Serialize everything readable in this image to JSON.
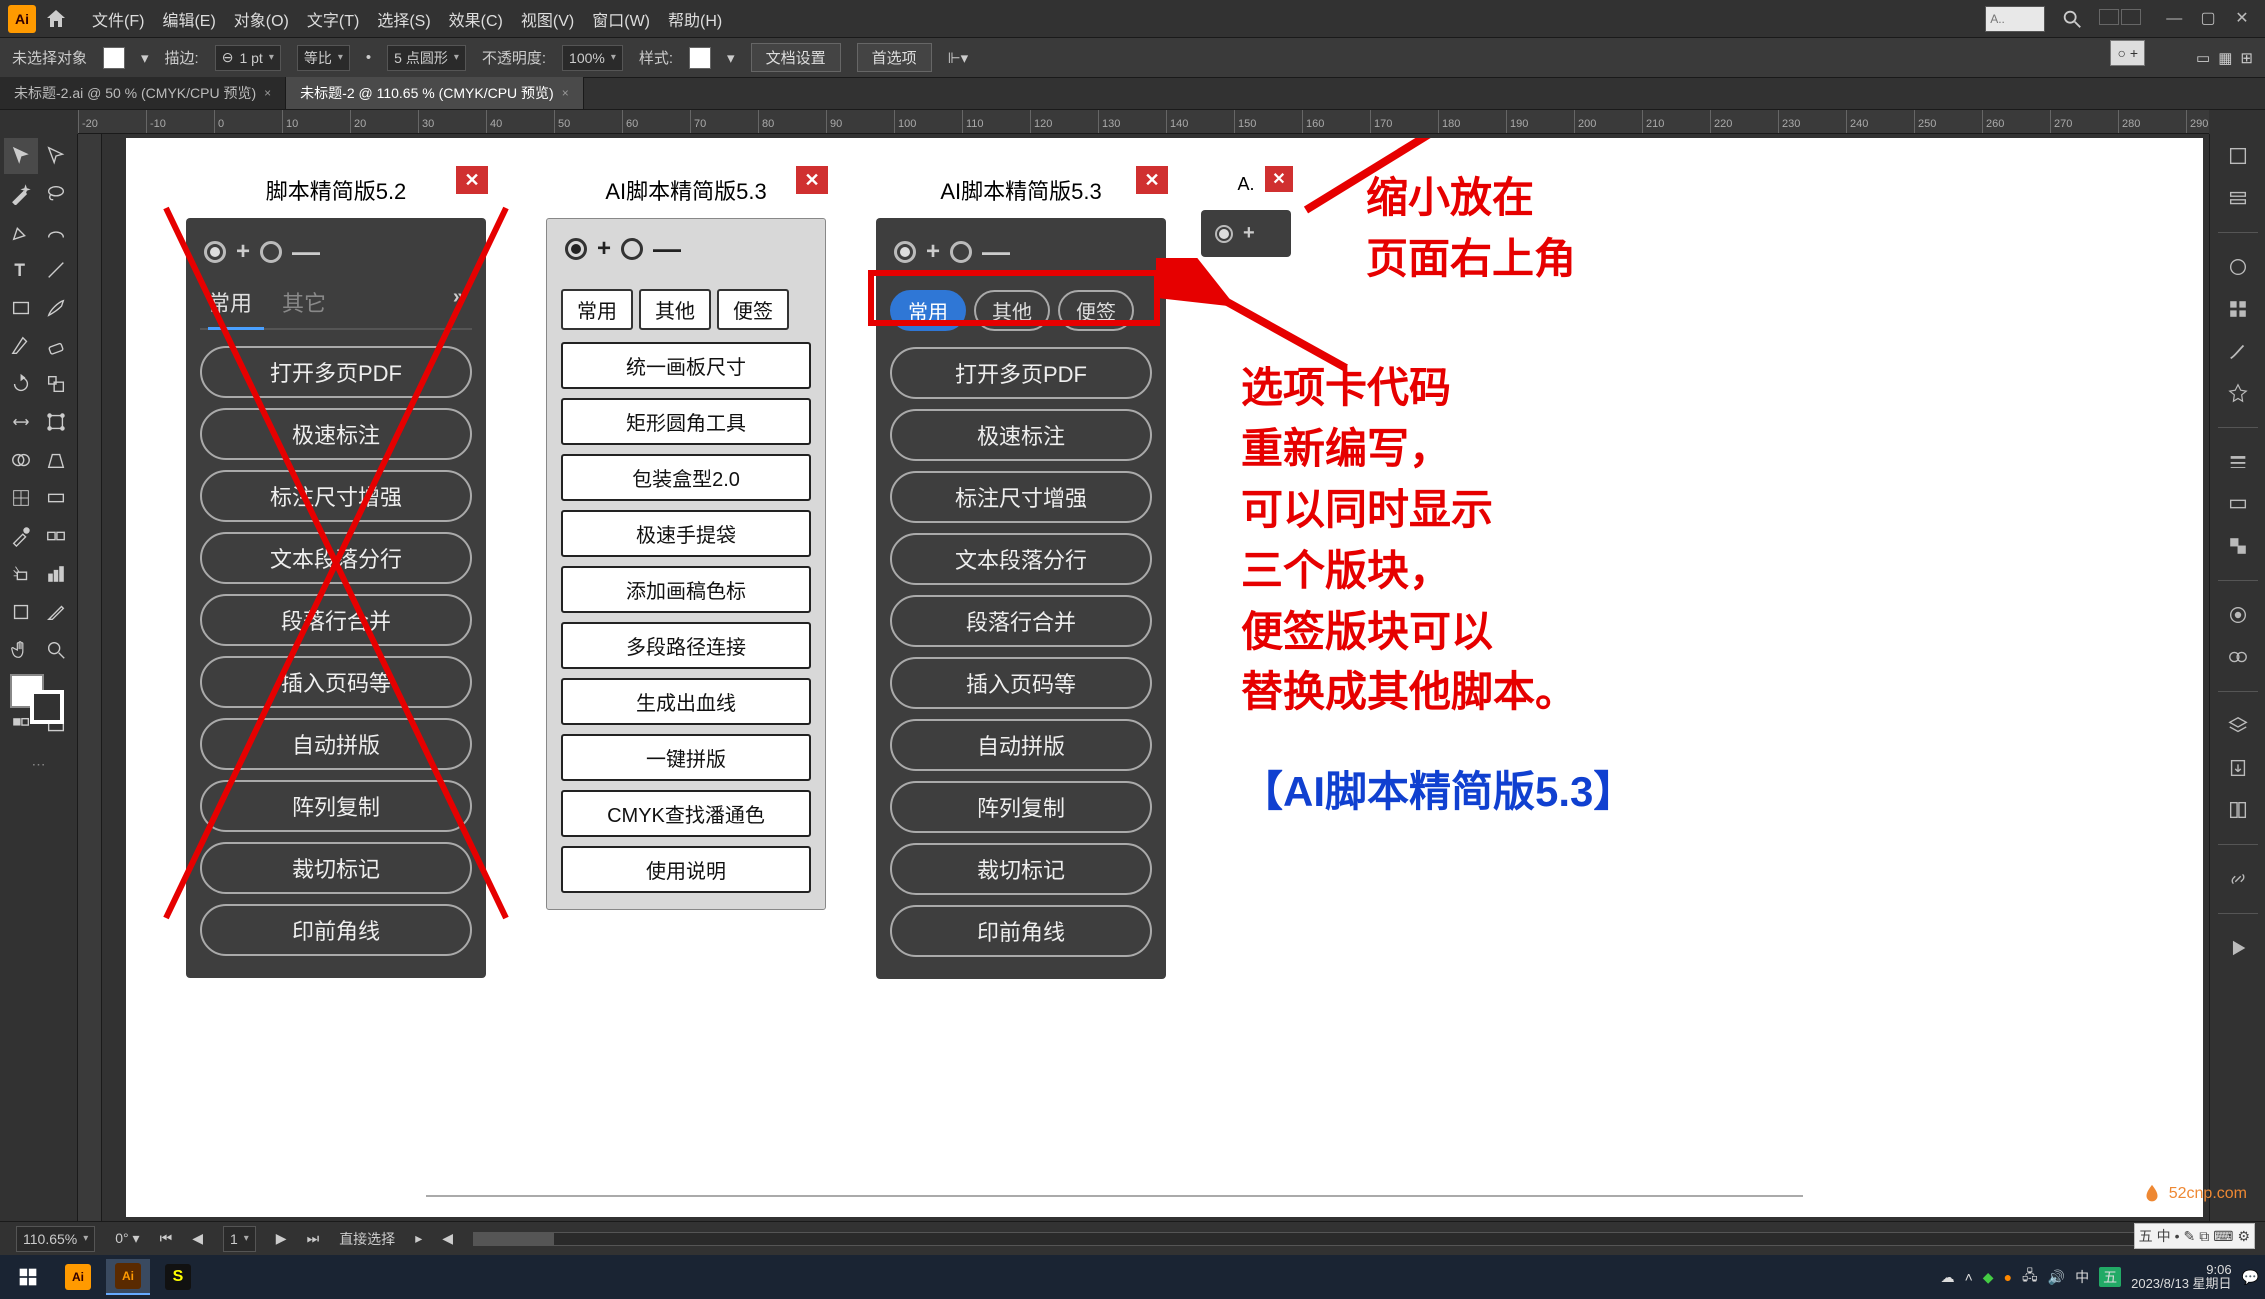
{
  "app": {
    "logo": "Ai",
    "menus": [
      "文件(F)",
      "编辑(E)",
      "对象(O)",
      "文字(T)",
      "选择(S)",
      "效果(C)",
      "视图(V)",
      "窗口(W)",
      "帮助(H)"
    ],
    "search_placeholder": "A..",
    "doc_tabs": [
      {
        "label": "未标题-2.ai @ 50 % (CMYK/CPU 预览)",
        "active": false
      },
      {
        "label": "未标题-2 @ 110.65 % (CMYK/CPU 预览)",
        "active": true
      }
    ],
    "controlbar": {
      "noselect": "未选择对象",
      "stroke_label": "描边:",
      "stroke_val": "1 pt",
      "uniform": "等比",
      "pt5": "5 点圆形",
      "opacity_label": "不透明度:",
      "opacity_val": "100%",
      "style_label": "样式:",
      "docsetup": "文档设置",
      "prefs": "首选项"
    },
    "status": {
      "zoom": "110.65%",
      "artboard_nav": "1",
      "tool": "直接选择"
    }
  },
  "ruler_ticks": [
    -20,
    -10,
    0,
    10,
    20,
    30,
    40,
    50,
    60,
    70,
    80,
    90,
    100,
    110,
    120,
    130,
    140,
    150,
    160,
    170,
    180,
    190,
    200,
    210,
    220,
    230,
    240,
    250,
    260,
    270,
    280,
    290
  ],
  "panel52": {
    "title": "脚本精简版5.2",
    "tabs": [
      "常用",
      "其它"
    ],
    "buttons": [
      "打开多页PDF",
      "极速标注",
      "标注尺寸增强",
      "文本段落分行",
      "段落行合并",
      "插入页码等",
      "自动拼版",
      "阵列复制",
      "裁切标记",
      "印前角线"
    ]
  },
  "panel53_light": {
    "title": "AI脚本精简版5.3",
    "tabs": [
      "常用",
      "其他",
      "便签"
    ],
    "buttons": [
      "统一画板尺寸",
      "矩形圆角工具",
      "包装盒型2.0",
      "极速手提袋",
      "添加画稿色标",
      "多段路径连接",
      "生成出血线",
      "一键拼版",
      "CMYK查找潘通色",
      "使用说明"
    ]
  },
  "panel53_dark": {
    "title": "AI脚本精简版5.3",
    "tabs": [
      "常用",
      "其他",
      "便签"
    ],
    "buttons": [
      "打开多页PDF",
      "极速标注",
      "标注尺寸增强",
      "文本段落分行",
      "段落行合并",
      "插入页码等",
      "自动拼版",
      "阵列复制",
      "裁切标记",
      "印前角线"
    ]
  },
  "mini": {
    "title": "A."
  },
  "annotations": {
    "top": "缩小放在\n页面右上角",
    "mid": "选项卡代码\n重新编写，\n可以同时显示\n三个版块，\n便签版块可以\n替换成其他脚本。",
    "blue": "【AI脚本精简版5.3】"
  },
  "taskbar": {
    "time": "9:06",
    "date": "2023/8/13 星期日"
  },
  "watermark": "52cnp.com"
}
